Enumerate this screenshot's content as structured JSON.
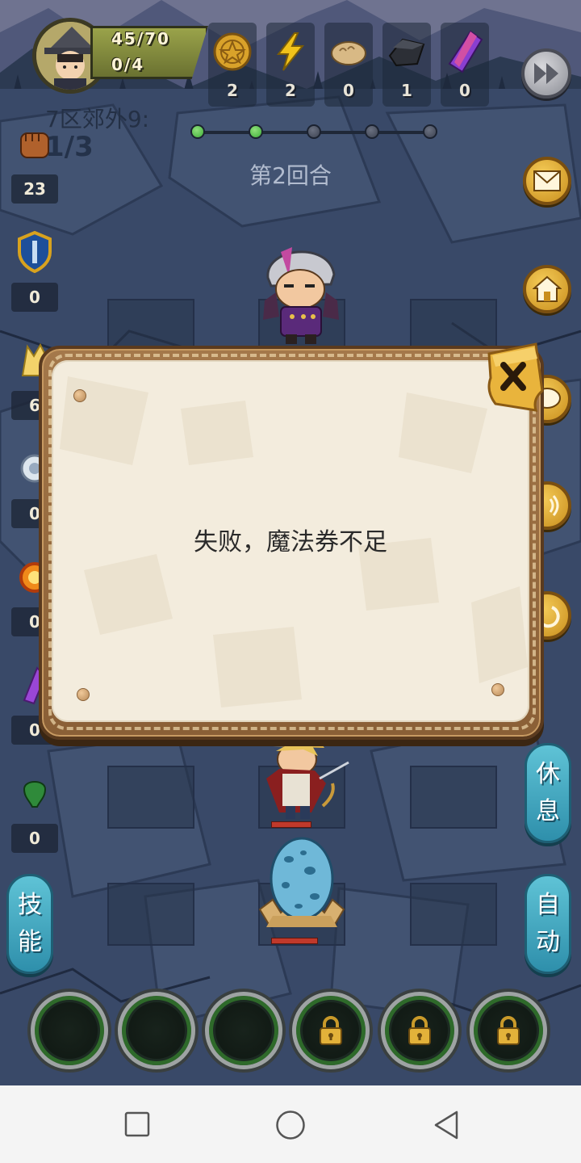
{
  "hud": {
    "energy": "45/70",
    "tickets": "0/4",
    "resources": [
      {
        "icon": "gold-coin-icon",
        "count": "2"
      },
      {
        "icon": "lightning-icon",
        "count": "2"
      },
      {
        "icon": "bread-icon",
        "count": "0"
      },
      {
        "icon": "iron-ore-icon",
        "count": "1"
      },
      {
        "icon": "crystal-icon",
        "count": "0"
      }
    ]
  },
  "stage": {
    "name": "7区郊外9:",
    "wave": "1/3",
    "round": "第2回合",
    "wave_progress": [
      true,
      true,
      false,
      false,
      false
    ]
  },
  "left_stats": [
    {
      "icon": "fist-icon",
      "value": "23"
    },
    {
      "icon": "shield-icon",
      "value": "0"
    },
    {
      "icon": "golden-wing-icon",
      "value": "6"
    },
    {
      "icon": "white-orb-icon",
      "value": "0"
    },
    {
      "icon": "fire-ring-icon",
      "value": "0"
    },
    {
      "icon": "purple-crystal-icon",
      "value": "0"
    },
    {
      "icon": "green-gem-icon",
      "value": "0"
    }
  ],
  "buttons": {
    "rest": [
      "休",
      "息"
    ],
    "skill": [
      "技",
      "能"
    ],
    "auto": [
      "自",
      "动"
    ]
  },
  "dialog": {
    "message": "失败，魔法券不足"
  },
  "skill_slots": [
    {
      "locked": false
    },
    {
      "locked": false
    },
    {
      "locked": false
    },
    {
      "locked": true
    },
    {
      "locked": true
    },
    {
      "locked": true
    }
  ],
  "colors": {
    "progress_active": "#3fae3a",
    "progress_inactive": "#3d4352",
    "dialog_paper": "#f3ecdd",
    "side_button": "#3fa6bf",
    "round_button": "#e7b23d"
  }
}
